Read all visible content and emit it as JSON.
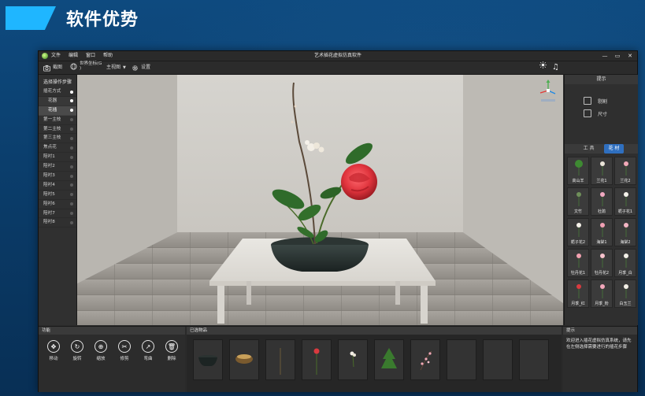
{
  "slide": {
    "title": "软件优势"
  },
  "app": {
    "menu": [
      "文件",
      "编辑",
      "窗口",
      "帮助"
    ],
    "window_title": "艺术插花虚拟仿真软件",
    "win_controls": [
      "—",
      "▭",
      "✕"
    ],
    "toolbar": {
      "screenshot": "截图",
      "coord_line1": "世界坐标(G",
      "coord_line2": ")",
      "view": "主视图",
      "settings": "设置"
    },
    "left_panel": {
      "header": "选择操作步骤",
      "items": [
        {
          "label": "插花方式",
          "sub": false,
          "on": true
        },
        {
          "label": "花器",
          "sub": true,
          "on": true
        },
        {
          "label": "花插",
          "sub": true,
          "on": true,
          "selected": true
        },
        {
          "label": "第一主枝",
          "sub": false,
          "on": false
        },
        {
          "label": "第二主枝",
          "sub": false,
          "on": false
        },
        {
          "label": "第三主枝",
          "sub": false,
          "on": false
        },
        {
          "label": "焦点花",
          "sub": false,
          "on": false
        },
        {
          "label": "陪衬1",
          "sub": false,
          "on": false
        },
        {
          "label": "陪衬2",
          "sub": false,
          "on": false
        },
        {
          "label": "陪衬3",
          "sub": false,
          "on": false
        },
        {
          "label": "陪衬4",
          "sub": false,
          "on": false
        },
        {
          "label": "陪衬5",
          "sub": false,
          "on": false
        },
        {
          "label": "陪衬6",
          "sub": false,
          "on": false
        },
        {
          "label": "陪衬7",
          "sub": false,
          "on": false
        },
        {
          "label": "陪衬8",
          "sub": false,
          "on": false
        }
      ]
    },
    "right_panel": {
      "header": "提示",
      "row1": "剔割",
      "row2": "尺寸",
      "tabs": [
        "工 具",
        "花 材"
      ],
      "active_tab": 1,
      "flowers": [
        "高山羊",
        "兰花1",
        "兰花2",
        "文竹",
        "杜鹃",
        "栀子花1",
        "栀子花2",
        "海棠1",
        "海棠2",
        "牡丹花1",
        "牡丹花2",
        "月季_白",
        "月季_红",
        "月季_粉",
        "白玉兰"
      ]
    },
    "bottom": {
      "tools_header": "功能",
      "tools": [
        {
          "label": "移动",
          "icon": "move-icon",
          "glyph": "✥"
        },
        {
          "label": "旋转",
          "icon": "rotate-icon",
          "glyph": "↻"
        },
        {
          "label": "缩放",
          "icon": "zoom-icon",
          "glyph": "⊕"
        },
        {
          "label": "修剪",
          "icon": "scissors-icon",
          "glyph": "✂"
        },
        {
          "label": "弯曲",
          "icon": "bend-icon",
          "glyph": "↗"
        },
        {
          "label": "删除",
          "icon": "delete-icon",
          "glyph": "🗑"
        }
      ],
      "selected_header": "已选物品",
      "hint_header": "提示",
      "hint_text": "欢迎进入插花虚拟仿真系统，请先在左侧选择需要进行的插花步骤"
    },
    "colors": {
      "accent": "#1fb6ff",
      "tab_active": "#2f6fbf",
      "rose": "#e0343d"
    }
  }
}
